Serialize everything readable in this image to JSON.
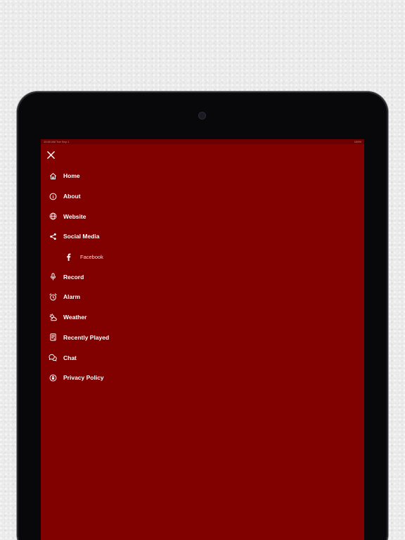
{
  "status_bar": {
    "left": "10:40 AM  Tue Sep 1",
    "right": "100%"
  },
  "menu": {
    "items": [
      {
        "label": "Home",
        "icon": "home-icon"
      },
      {
        "label": "About",
        "icon": "info-icon"
      },
      {
        "label": "Website",
        "icon": "globe-icon"
      },
      {
        "label": "Social Media",
        "icon": "share-icon"
      },
      {
        "label": "Facebook",
        "icon": "facebook-icon",
        "sub": true
      },
      {
        "label": "Record",
        "icon": "microphone-icon"
      },
      {
        "label": "Alarm",
        "icon": "alarm-clock-icon"
      },
      {
        "label": "Weather",
        "icon": "weather-icon"
      },
      {
        "label": "Recently Played",
        "icon": "playlist-icon"
      },
      {
        "label": "Chat",
        "icon": "chat-icon"
      },
      {
        "label": "Privacy Policy",
        "icon": "privacy-icon"
      }
    ]
  },
  "colors": {
    "background": "#810000",
    "text": "#ffffff"
  }
}
